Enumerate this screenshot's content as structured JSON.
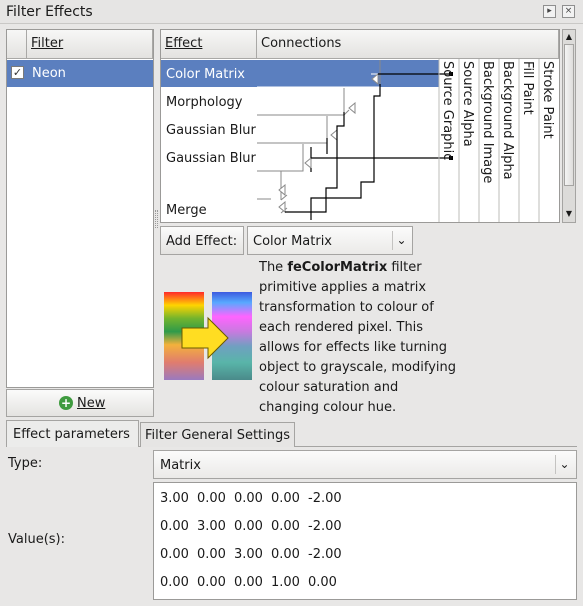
{
  "window": {
    "title": "Filter Effects"
  },
  "filter_list": {
    "header": "Filter",
    "items": [
      {
        "label": "Neon",
        "checked": true,
        "selected": true
      }
    ],
    "new_button": "New"
  },
  "effects": {
    "col_effect": "Effect",
    "col_connections": "Connections",
    "items": [
      "Color Matrix",
      "Morphology",
      "Gaussian Blur",
      "Gaussian Blur",
      "Merge"
    ],
    "sources": [
      "Source Graphic",
      "Source Alpha",
      "Background Image",
      "Background Alpha",
      "Fill Paint",
      "Stroke Paint"
    ],
    "add_effect_label": "Add Effect:",
    "add_effect_value": "Color Matrix"
  },
  "description": {
    "prefix": "The ",
    "name": "feColorMatrix",
    "text": " filter primitive applies a matrix transformation to colour of each rendered pixel. This allows for effects like turning object to grayscale, modifying colour saturation and changing colour hue."
  },
  "tabs": [
    "Effect parameters",
    "Filter General Settings"
  ],
  "params": {
    "type_label": "Type:",
    "type_value": "Matrix",
    "values_label": "Value(s):",
    "matrix": [
      [
        "3.00",
        "0.00",
        "0.00",
        "0.00",
        "-2.00"
      ],
      [
        "0.00",
        "3.00",
        "0.00",
        "0.00",
        "-2.00"
      ],
      [
        "0.00",
        "0.00",
        "3.00",
        "0.00",
        "-2.00"
      ],
      [
        "0.00",
        "0.00",
        "0.00",
        "1.00",
        "0.00"
      ]
    ]
  },
  "colors": {
    "selection": "#5b7fbf",
    "arrow": "#ffdd22"
  }
}
